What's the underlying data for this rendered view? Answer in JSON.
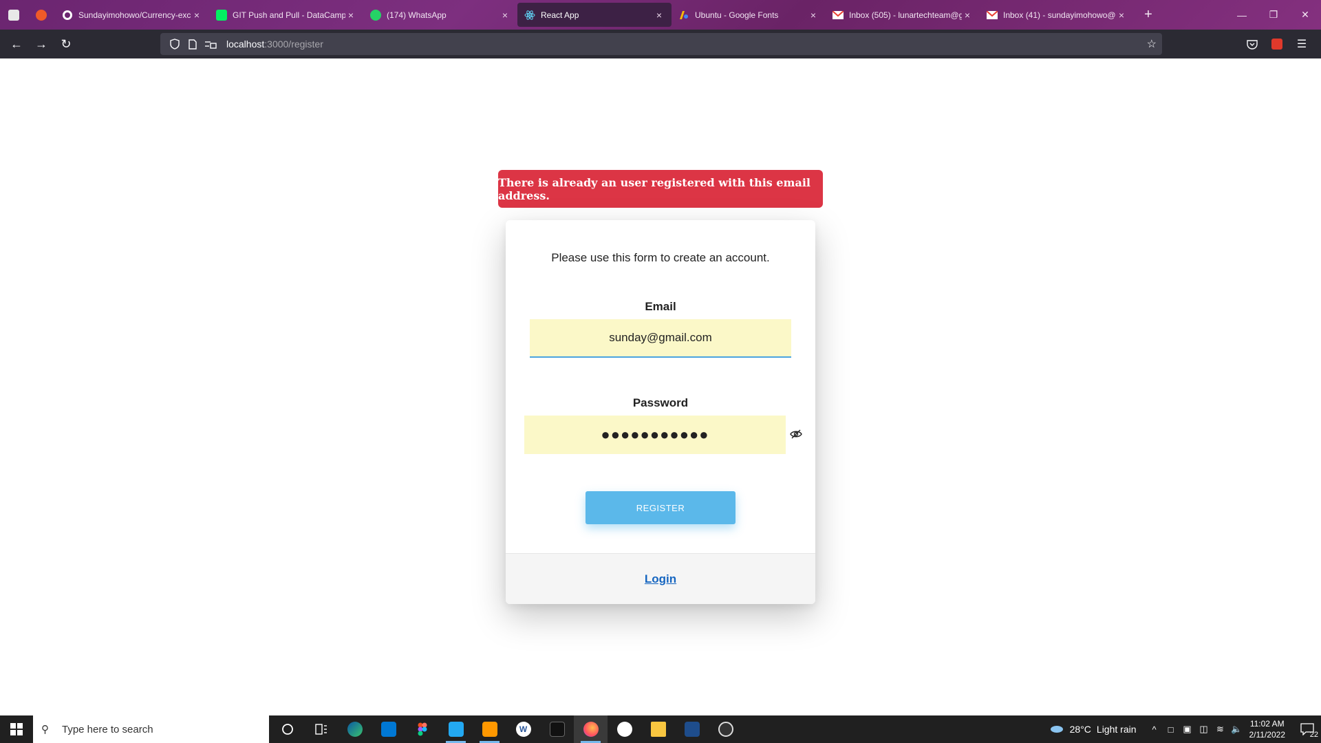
{
  "browser": {
    "tabs": [
      {
        "title": "Sundayimohowo/Currency-exc",
        "favicon": "github-icon",
        "active": false
      },
      {
        "title": "GIT Push and Pull - DataCamp",
        "favicon": "datacamp-icon",
        "active": false
      },
      {
        "title": "(174) WhatsApp",
        "favicon": "whatsapp-icon",
        "active": false
      },
      {
        "title": "React App",
        "favicon": "react-icon",
        "active": true
      },
      {
        "title": "Ubuntu - Google Fonts",
        "favicon": "google-fonts-icon",
        "active": false
      },
      {
        "title": "Inbox (505) - lunartechteam@g",
        "favicon": "gmail-icon",
        "active": false
      },
      {
        "title": "Inbox (41) - sundayimohowo@",
        "favicon": "gmail-icon",
        "active": false
      }
    ],
    "url_host": "localhost",
    "url_path": ":3000/register",
    "tab_close": "×",
    "new_tab": "+"
  },
  "page": {
    "alert_text": "There is already an user registered with this email address.",
    "intro_text": "Please use this form to create an account.",
    "email_label": "Email",
    "email_value": "sunday@gmail.com",
    "password_label": "Password",
    "password_value": "●●●●●●●●●●●",
    "register_label": "REGISTER",
    "login_label": "Login"
  },
  "taskbar": {
    "search_placeholder": "Type here to search",
    "weather_temp": "28°C",
    "weather_desc": "Light rain",
    "time": "11:02 AM",
    "date": "2/11/2022",
    "notification_count": "22"
  },
  "colors": {
    "alert_bg": "#dc3545",
    "button_bg": "#5bb8ea",
    "autofill_bg": "#fbf8c8",
    "link": "#1565c0",
    "tabstrip": "#6b2570"
  }
}
